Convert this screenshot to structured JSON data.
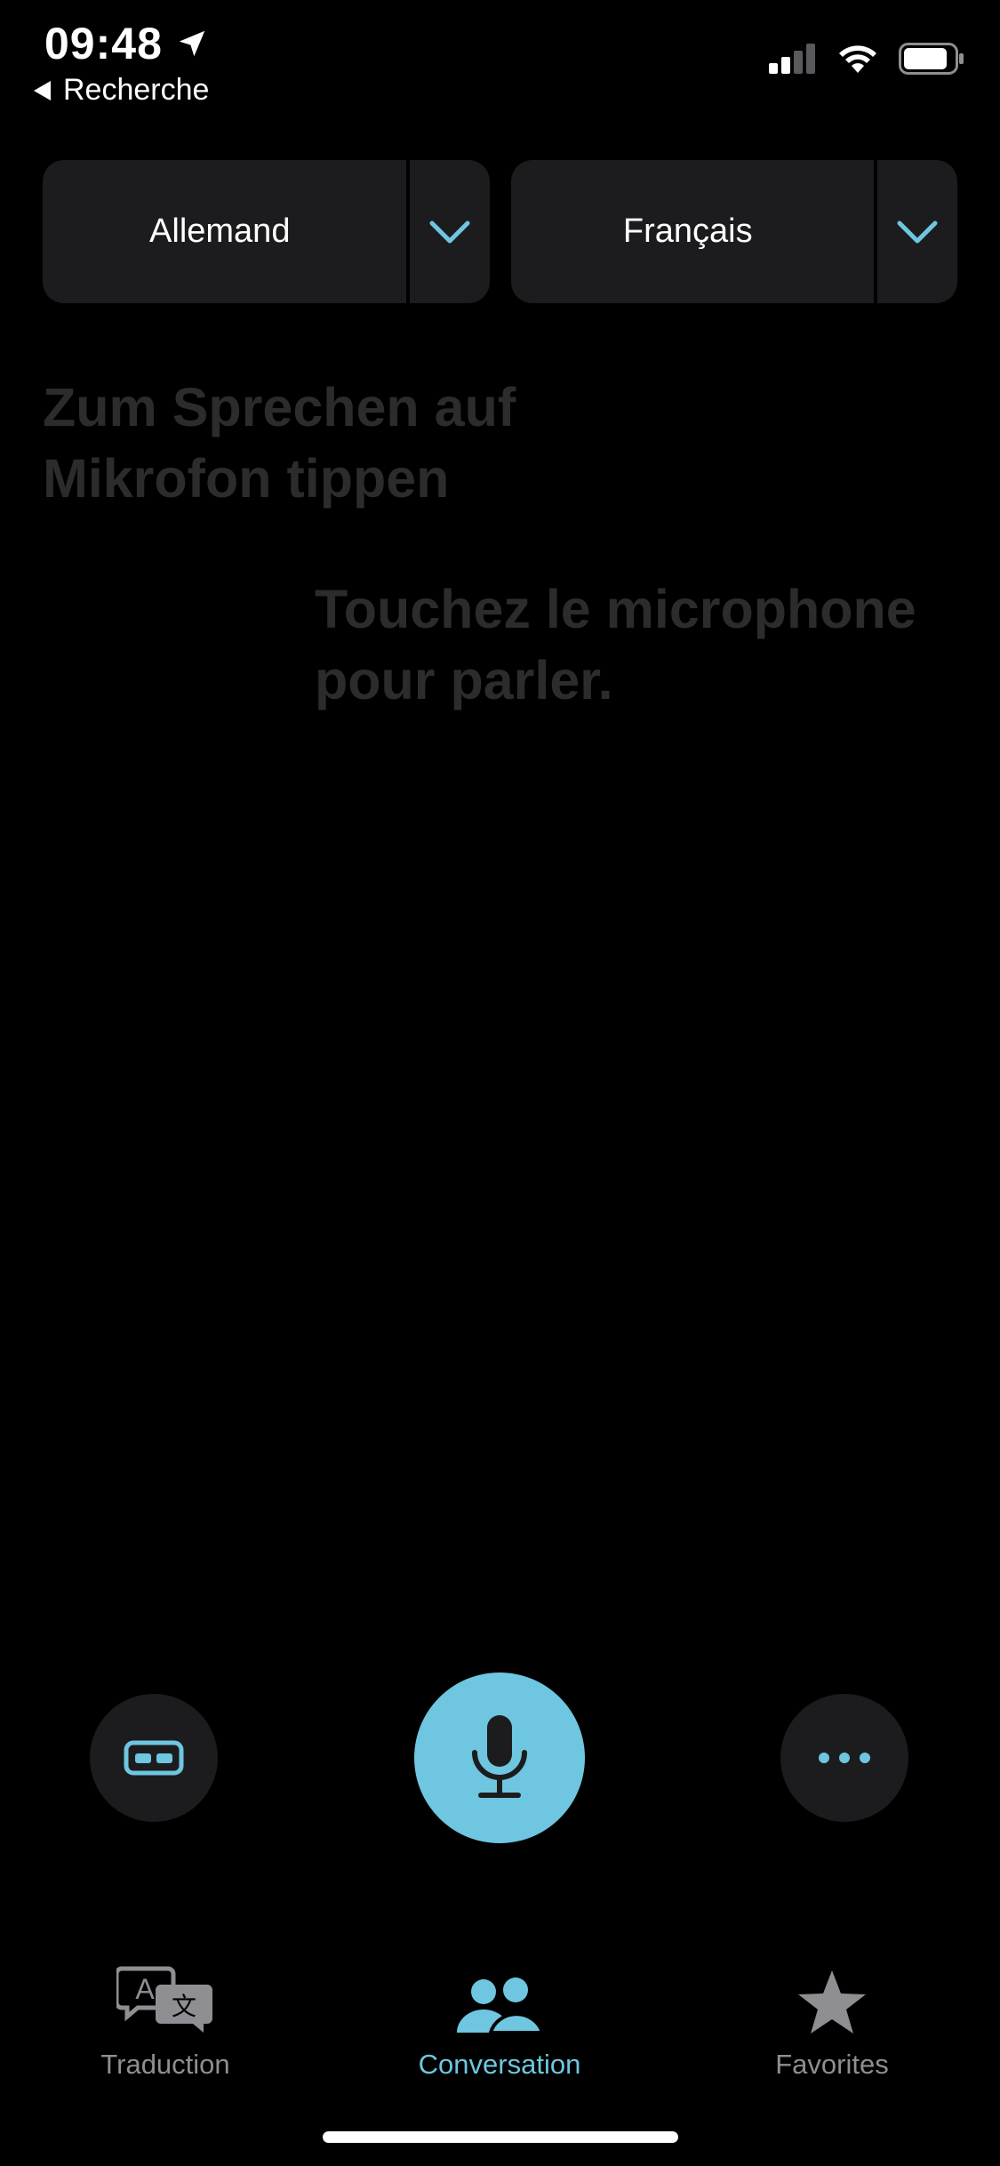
{
  "status_bar": {
    "time": "09:48",
    "back_label": "Recherche"
  },
  "languages": {
    "source": "Allemand",
    "target": "Français"
  },
  "prompts": {
    "source": "Zum Sprechen auf Mikrofon tippen",
    "target": "Touchez le microphone pour parler."
  },
  "controls": {
    "left_icon": "subtitles-icon",
    "center_icon": "microphone-icon",
    "right_icon": "ellipsis-icon"
  },
  "tabs": [
    {
      "label": "Traduction",
      "icon": "translate-icon",
      "active": false
    },
    {
      "label": "Conversation",
      "icon": "people-icon",
      "active": true
    },
    {
      "label": "Favorites",
      "icon": "star-icon",
      "active": false
    }
  ],
  "colors": {
    "accent": "#6ec6e0",
    "background": "#000000",
    "surface": "#1c1c1e",
    "inactive": "#8e8e93",
    "prompt_text": "#2c2c2e"
  }
}
